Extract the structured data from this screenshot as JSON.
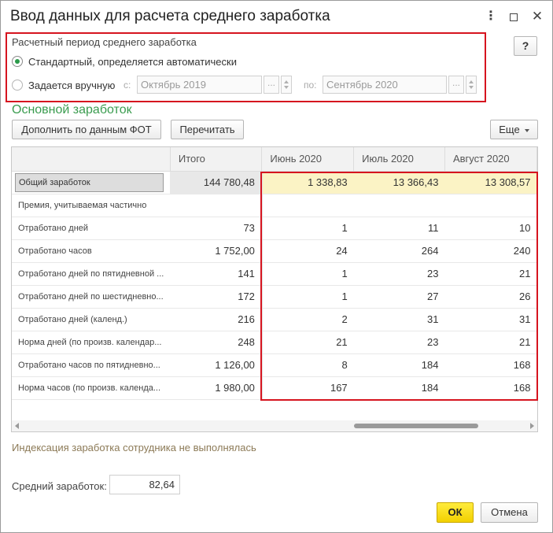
{
  "window": {
    "title": "Ввод данных для расчета среднего заработка",
    "menu_glyph": "⋮",
    "close_glyph": "✕"
  },
  "period": {
    "label": "Расчетный период среднего заработка",
    "option_auto": "Стандартный, определяется автоматически",
    "option_manual": "Задается вручную",
    "from_label": "с:",
    "from_value": "Октябрь 2019",
    "to_label": "по:",
    "to_value": "Сентябрь 2020",
    "dots": "...",
    "selected": "auto"
  },
  "help_label": "?",
  "section_title": "Основной заработок",
  "toolbar": {
    "fill_label": "Дополнить по данным ФОТ",
    "recalc_label": "Перечитать",
    "more_label": "Еще"
  },
  "table": {
    "columns": [
      "",
      "Итого",
      "Июнь 2020",
      "Июль 2020",
      "Август 2020"
    ],
    "rows": [
      {
        "label": "Общий заработок",
        "values": [
          "144 780,48",
          "1 338,83",
          "13 366,43",
          "13 308,57"
        ]
      },
      {
        "label": "Премия, учитываемая частично",
        "values": [
          "",
          "",
          "",
          ""
        ]
      },
      {
        "label": "Отработано дней",
        "values": [
          "73",
          "1",
          "11",
          "10"
        ]
      },
      {
        "label": "Отработано часов",
        "values": [
          "1 752,00",
          "24",
          "264",
          "240"
        ]
      },
      {
        "label": "Отработано дней по пятидневной ...",
        "values": [
          "141",
          "1",
          "23",
          "21"
        ]
      },
      {
        "label": "Отработано дней по шестидневно...",
        "values": [
          "172",
          "1",
          "27",
          "26"
        ]
      },
      {
        "label": "Отработано дней (календ.)",
        "values": [
          "216",
          "2",
          "31",
          "31"
        ]
      },
      {
        "label": "Норма дней (по произв. календар...",
        "values": [
          "248",
          "21",
          "23",
          "21"
        ]
      },
      {
        "label": "Отработано часов по пятидневно...",
        "values": [
          "1 126,00",
          "8",
          "184",
          "168"
        ]
      },
      {
        "label": "Норма часов (по произв. календа...",
        "values": [
          "1 980,00",
          "167",
          "184",
          "168"
        ]
      }
    ]
  },
  "index_note": "Индексация заработка сотрудника не выполнялась",
  "average": {
    "label": "Средний заработок:",
    "value": "82,64"
  },
  "footer": {
    "ok_label": "ОК",
    "cancel_label": "Отмена"
  },
  "colors": {
    "highlight_red": "#d6141f",
    "section_green": "#3a9c4f",
    "ok_yellow": "#f2d000",
    "row_highlight": "#fbf3c5"
  }
}
